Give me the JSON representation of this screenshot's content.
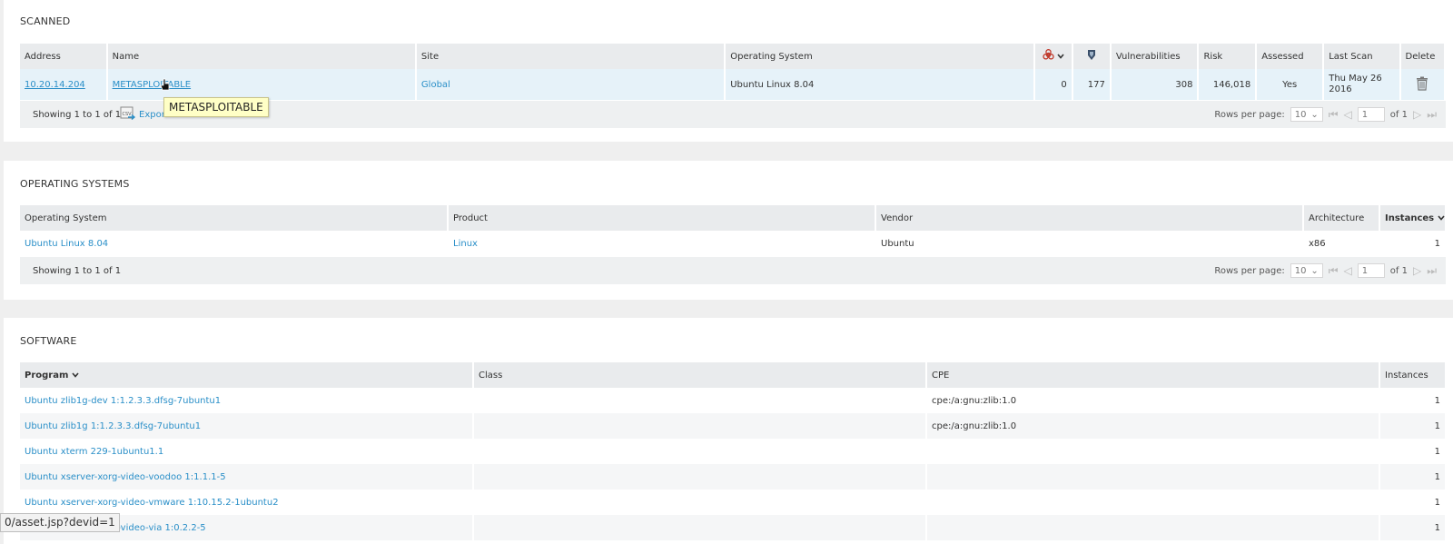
{
  "scanned": {
    "title": "SCANNED",
    "headers": {
      "address": "Address",
      "name": "Name",
      "site": "Site",
      "os": "Operating System",
      "vulnerabilities": "Vulnerabilities",
      "risk": "Risk",
      "assessed": "Assessed",
      "last_scan": "Last Scan",
      "delete": "Delete"
    },
    "row": {
      "address": "10.20.14.204",
      "name": "METASPLOITABLE",
      "site": "Global",
      "os": "Ubuntu Linux 8.04",
      "malware": "0",
      "exploits": "177",
      "vulnerabilities": "308",
      "risk": "146,018",
      "assessed": "Yes",
      "last_scan_line1": "Thu May 26",
      "last_scan_line2": "2016"
    },
    "showing": "Showing 1 to 1 of 1",
    "export_label": "Expor",
    "rows_per_page_label": "Rows per page:",
    "rows_per_page_value": "10",
    "page_value": "1",
    "of_pages": "of 1",
    "tooltip": "METASPLOITABLE"
  },
  "operating_systems": {
    "title": "OPERATING SYSTEMS",
    "headers": {
      "os": "Operating System",
      "product": "Product",
      "vendor": "Vendor",
      "architecture": "Architecture",
      "instances": "Instances"
    },
    "row": {
      "os": "Ubuntu Linux 8.04",
      "product": "Linux",
      "vendor": "Ubuntu",
      "architecture": "x86",
      "instances": "1"
    },
    "showing": "Showing 1 to 1 of 1",
    "rows_per_page_label": "Rows per page:",
    "rows_per_page_value": "10",
    "page_value": "1",
    "of_pages": "of 1"
  },
  "software": {
    "title": "SOFTWARE",
    "headers": {
      "program": "Program",
      "class": "Class",
      "cpe": "CPE",
      "instances": "Instances"
    },
    "rows": [
      {
        "program": "Ubuntu zlib1g-dev 1:1.2.3.3.dfsg-7ubuntu1",
        "class": "",
        "cpe": "cpe:/a:gnu:zlib:1.0",
        "instances": "1"
      },
      {
        "program": "Ubuntu zlib1g 1:1.2.3.3.dfsg-7ubuntu1",
        "class": "",
        "cpe": "cpe:/a:gnu:zlib:1.0",
        "instances": "1"
      },
      {
        "program": "Ubuntu xterm 229-1ubuntu1.1",
        "class": "",
        "cpe": "",
        "instances": "1"
      },
      {
        "program": "Ubuntu xserver-xorg-video-voodoo 1:1.1.1-5",
        "class": "",
        "cpe": "",
        "instances": "1"
      },
      {
        "program": "Ubuntu xserver-xorg-video-vmware 1:10.15.2-1ubuntu2",
        "class": "",
        "cpe": "",
        "instances": "1"
      },
      {
        "program": "Ubuntu xserver-xorg-video-via 1:0.2.2-5",
        "class": "",
        "cpe": "",
        "instances": "1"
      }
    ]
  },
  "status_bar": {
    "url": "0/asset.jsp?devid=1"
  },
  "colors": {
    "link": "#2a8fc8",
    "header_bg": "#e9ebed",
    "highlight_row": "#e6f2f9",
    "malware_icon": "#c0392b",
    "tooltip_bg": "#ffffc6"
  }
}
